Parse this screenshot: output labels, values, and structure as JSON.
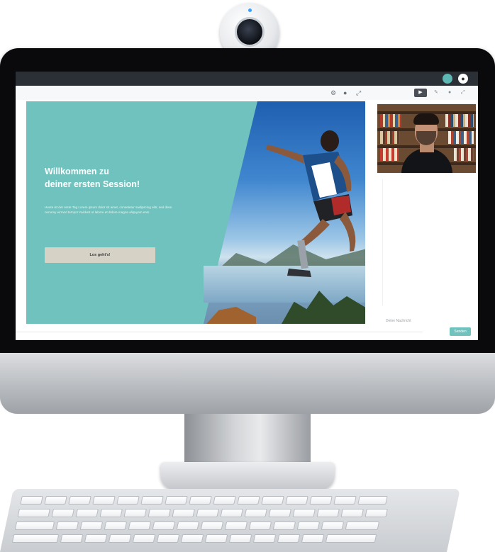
{
  "app": {
    "user_avatar_initial": "",
    "second_avatar_initial": "●"
  },
  "toolbar": {
    "icons": [
      "settings-icon",
      "record-icon",
      "expand-icon"
    ]
  },
  "slide": {
    "title_line1": "Willkommen zu",
    "title_line2": "deiner ersten Session!",
    "body": "Heute ist der erste Tag Lorem ipsum dolor sit amet, consetetur sadipscing elitr, sed diam nonumy eirmod tempor invidunt ut labore et dolore magna aliquyam erat.",
    "button_label": "Los geht's!"
  },
  "right_panel": {
    "tools": [
      "video-icon",
      "pencil-icon",
      "dot-icon",
      "fullscreen-icon"
    ],
    "chat_placeholder": "Deine Nachricht",
    "send_label": "Senden"
  },
  "colors": {
    "accent": "#6fc2bd",
    "button": "#d6d2c6",
    "topbar": "#2b2f36"
  }
}
